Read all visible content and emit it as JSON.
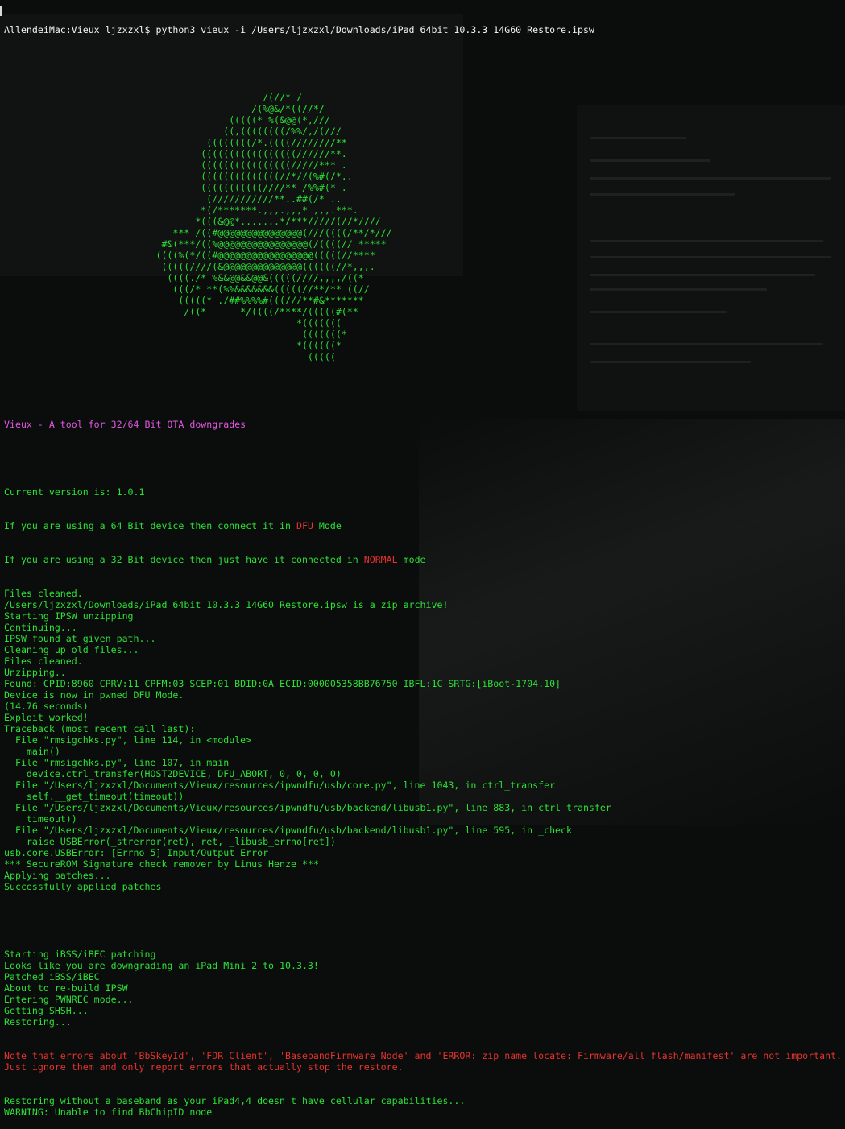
{
  "terminal": {
    "prompt": "AllendeiMac:Vieux ljzxzxl$ python3 vieux -i /Users/ljzxzxl/Downloads/iPad_64bit_10.3.3_14G60_Restore.ipsw",
    "ascii_art": [
      "                                              /(//* /",
      "                                            /(%@&/*((//*/",
      "                                        (((((* %(&@@(*,///",
      "                                       ((,((((((((/%%/,/(///",
      "                                    ((((((((/*.((((////////**",
      "                                   (((((((((((((((((//////**.",
      "                                   ((((((((((((((((/////*** .",
      "                                   ((((((((((((((//*//(%#(/*..",
      "                                   (((((((((((////** /%%#(* .",
      "                                    (///////////**..##(/* ..",
      "                                   *(/*******.,,,.,,,* ,,,.***.",
      "                                  *(((&@@*.......*/***/////(//*////",
      "                              *** /((#@@@@@@@@@@@@@@@(///((((/**/*///",
      "                            #&(***/((%@@@@@@@@@@@@@@@@(/((((// *****",
      "                           ((((%(*/((#@@@@@@@@@@@@@@@@@(((((//****",
      "                            (((((////(&@@@@@@@@@@@@@@((((((//*,,,.",
      "                             ((((./* %&&@@&&@@&(((((////,,,,/((*",
      "                              (((/* **(%%&&&&&&&(((((//**/** ((//",
      "                               (((((* ./##%%%%#(((///**#&*******",
      "                                /((*      */((((/****/(((((#(**",
      "                                                    *(((((((",
      "                                                     (((((((*",
      "                                                    *((((((*",
      "                                                      ((((("
    ],
    "tool_banner": "Vieux - A tool for 32/64 Bit OTA downgrades",
    "version_line": "Current version is: 1.0.1",
    "dfu_line": {
      "before": "If you are using a 64 Bit device then connect it in ",
      "highlight": "DFU",
      "after": " Mode"
    },
    "normal_line": {
      "before": "If you are using a 32 Bit device then just have it connected in ",
      "highlight": "NORMAL",
      "after": " mode"
    },
    "output_lines": [
      "Files cleaned.",
      "/Users/ljzxzxl/Downloads/iPad_64bit_10.3.3_14G60_Restore.ipsw is a zip archive!",
      "Starting IPSW unzipping",
      "Continuing...",
      "IPSW found at given path...",
      "Cleaning up old files...",
      "Files cleaned.",
      "Unzipping..",
      "Found: CPID:8960 CPRV:11 CPFM:03 SCEP:01 BDID:0A ECID:000005358BB76750 IBFL:1C SRTG:[iBoot-1704.10]",
      "Device is now in pwned DFU Mode.",
      "(14.76 seconds)",
      "Exploit worked!",
      "Traceback (most recent call last):",
      "  File \"rmsigchks.py\", line 114, in <module>",
      "    main()",
      "  File \"rmsigchks.py\", line 107, in main",
      "    device.ctrl_transfer(HOST2DEVICE, DFU_ABORT, 0, 0, 0, 0)",
      "  File \"/Users/ljzxzxl/Documents/Vieux/resources/ipwndfu/usb/core.py\", line 1043, in ctrl_transfer",
      "    self.__get_timeout(timeout))",
      "  File \"/Users/ljzxzxl/Documents/Vieux/resources/ipwndfu/usb/backend/libusb1.py\", line 883, in ctrl_transfer",
      "    timeout))",
      "  File \"/Users/ljzxzxl/Documents/Vieux/resources/ipwndfu/usb/backend/libusb1.py\", line 595, in _check",
      "    raise USBError(_strerror(ret), ret, _libusb_errno[ret])",
      "usb.core.USBError: [Errno 5] Input/Output Error",
      "*** SecureROM Signature check remover by Linus Henze ***",
      "Applying patches...",
      "Successfully applied patches"
    ],
    "output_lines_2": [
      "Starting iBSS/iBEC patching",
      "Looks like you are downgrading an iPad Mini 2 to 10.3.3!",
      "Patched iBSS/iBEC",
      "About to re-build IPSW",
      "Entering PWNREC mode...",
      "Getting SHSH...",
      "Restoring..."
    ],
    "error_lines": [
      "Note that errors about 'BbSkeyId', 'FDR Client', 'BasebandFirmware Node' and 'ERROR: zip_name_locate: Firmware/all_flash/manifest' are not important.",
      "Just ignore them and only report errors that actually stop the restore."
    ],
    "tail_lines": [
      "Restoring without a baseband as your iPad4,4 doesn't have cellular capabilities...",
      "WARNING: Unable to find BbChipID node"
    ],
    "colors": {
      "text": "#2be135",
      "prompt": "#f2f2f2",
      "banner": "#e158e1",
      "highlight": "#e5332f",
      "background": "#0b0c0c"
    }
  }
}
